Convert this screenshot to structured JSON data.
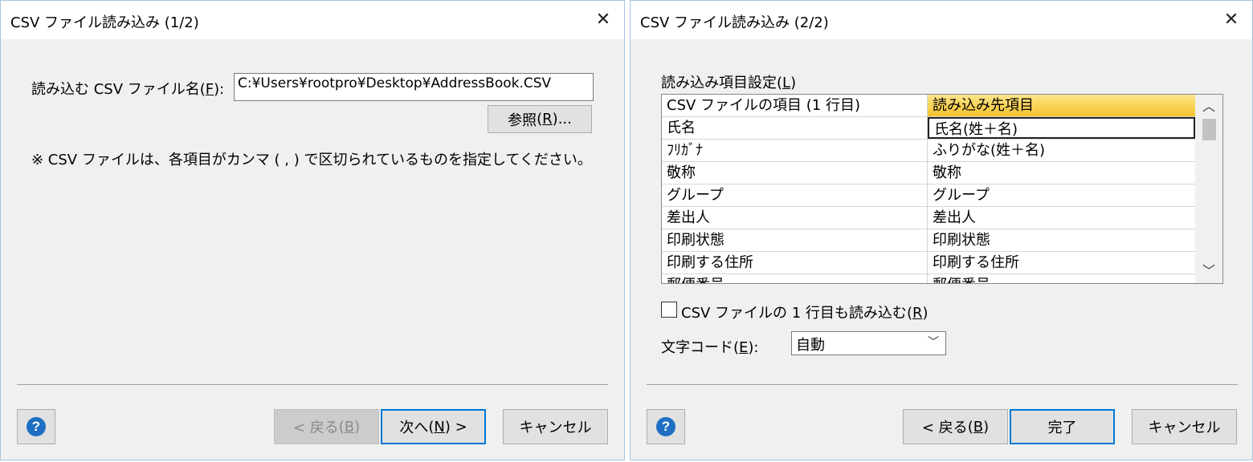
{
  "dialog1": {
    "title": "CSV ファイル読み込み (1/2)",
    "close_glyph": "✕",
    "file_label": "読み込む CSV ファイル名",
    "file_mnemonic": "F",
    "file_value": "C:¥Users¥rootpro¥Desktop¥AddressBook.CSV",
    "browse_label": "参照",
    "browse_mnemonic": "R",
    "note": "※ CSV ファイルは、各項目がカンマ ( , ) で区切られているものを指定してください。",
    "help_glyph": "?",
    "back_label": "< 戻る",
    "back_mnemonic": "B",
    "next_label": "次へ",
    "next_mnemonic": "N",
    "cancel_label": "キャンセル"
  },
  "dialog2": {
    "title": "CSV ファイル読み込み (2/2)",
    "close_glyph": "✕",
    "settings_label": "読み込み項目設定",
    "settings_mnemonic": "L",
    "grid": {
      "header": [
        "CSV ファイルの項目 (1 行目)",
        "読み込み先項目"
      ],
      "rows": [
        [
          "氏名",
          "氏名(姓＋名)"
        ],
        [
          "ﾌﾘｶﾞﾅ",
          "ふりがな(姓＋名)"
        ],
        [
          "敬称",
          "敬称"
        ],
        [
          "グループ",
          "グループ"
        ],
        [
          "差出人",
          "差出人"
        ],
        [
          "印刷状態",
          "印刷状態"
        ],
        [
          "印刷する住所",
          "印刷する住所"
        ],
        [
          "郵便番号",
          "郵便番号"
        ]
      ],
      "scroll_up": "︿",
      "scroll_down": "﹀"
    },
    "first_row_label": "CSV ファイルの 1 行目も読み込む",
    "first_row_mnemonic": "R",
    "first_row_checked": false,
    "encoding_label": "文字コード",
    "encoding_mnemonic": "E",
    "encoding_value": "自動",
    "encoding_arrow": "﹀",
    "help_glyph": "?",
    "back_label": "< 戻る",
    "back_mnemonic": "B",
    "finish_label": "完了",
    "cancel_label": "キャンセル"
  },
  "colors": {
    "accent_border": "#0078d7",
    "header_highlight": "#f6c22b",
    "help_icon": "#1e6fc4"
  }
}
